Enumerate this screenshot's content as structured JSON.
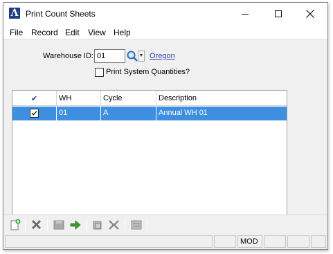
{
  "window": {
    "title": "Print Count Sheets",
    "app_icon_glyph": "Λ",
    "controls": [
      "minimize-icon",
      "maximize-icon",
      "close-icon"
    ]
  },
  "menu": {
    "items": [
      "File",
      "Record",
      "Edit",
      "View",
      "Help"
    ]
  },
  "form": {
    "warehouse_label": "Warehouse ID:",
    "warehouse_value": "01",
    "warehouse_name": "Oregon",
    "print_system_quantities_label": "Print System Quantities?",
    "print_system_quantities_checked": false
  },
  "grid": {
    "columns": [
      "✔",
      "WH",
      "Cycle",
      "Description"
    ],
    "rows": [
      {
        "selected": true,
        "wh": "01",
        "cycle": "A",
        "description": "Annual WH 01"
      }
    ],
    "selection_color": "#3f8fe0"
  },
  "toolbar": {
    "buttons": [
      "new-icon",
      "delete-icon",
      "save-icon",
      "go-icon",
      "copy-icon",
      "expand-icon",
      "list-icon"
    ]
  },
  "status": {
    "mode": "MOD"
  }
}
